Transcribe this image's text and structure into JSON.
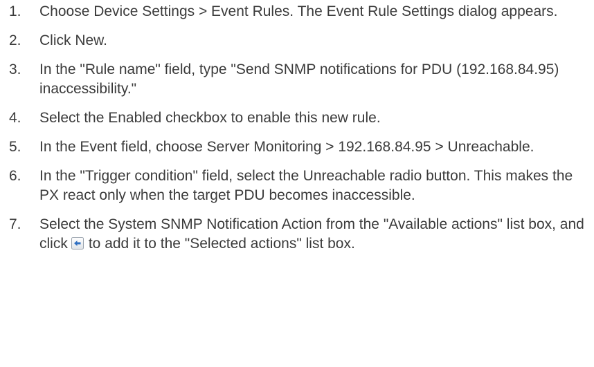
{
  "steps": [
    {
      "num": "1.",
      "text": "Choose Device Settings > Event Rules. The Event Rule Settings dialog appears."
    },
    {
      "num": "2.",
      "text": "Click New."
    },
    {
      "num": "3.",
      "text": "In the \"Rule name\" field, type \"Send SNMP notifications for PDU (192.168.84.95) inaccessibility.\""
    },
    {
      "num": "4.",
      "text": "Select the Enabled checkbox to enable this new rule."
    },
    {
      "num": "5.",
      "text": "In the Event field, choose Server Monitoring > 192.168.84.95 > Unreachable."
    },
    {
      "num": "6.",
      "text": "In the \"Trigger condition\" field, select the Unreachable radio button. This makes the PX react only when the target PDU becomes inaccessible."
    },
    {
      "num": "7.",
      "text_before": "Select the System SNMP Notification Action from the \"Available actions\" list box, and click",
      "text_after": "to add it to the \"Selected actions\" list box.",
      "icon": "add-arrow-icon"
    }
  ]
}
